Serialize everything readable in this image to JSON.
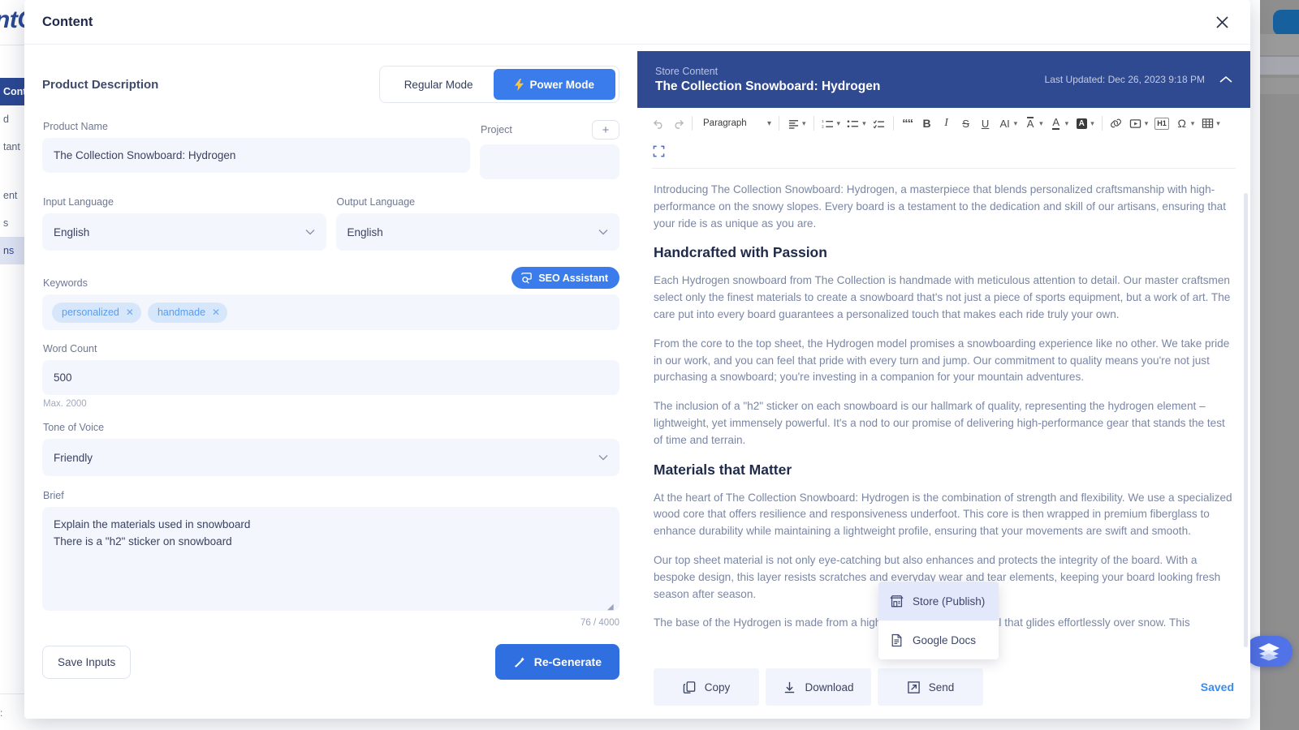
{
  "background": {
    "brand": "ntC",
    "nav": [
      {
        "label": "Conte",
        "state": "active"
      },
      {
        "label": "d",
        "state": "normal"
      },
      {
        "label": "tant",
        "state": "normal"
      },
      {
        "label": "ent",
        "state": "normal"
      },
      {
        "label": "s",
        "state": "normal"
      },
      {
        "label": "ns",
        "state": "sel"
      }
    ],
    "bottom_label": ":",
    "fab_icon": "layers-icon"
  },
  "modal": {
    "title": "Content",
    "close_icon": "close-icon"
  },
  "left": {
    "section_title": "Product Description",
    "modes": [
      {
        "label": "Regular Mode",
        "active": false,
        "icon": ""
      },
      {
        "label": "Power Mode",
        "active": true,
        "icon": "lightning-icon"
      }
    ],
    "product_name": {
      "label": "Product Name",
      "value": "The Collection Snowboard: Hydrogen"
    },
    "project": {
      "label": "Project",
      "value": "",
      "placeholder": "",
      "add_icon": "plus-icon"
    },
    "input_language": {
      "label": "Input Language",
      "value": "English"
    },
    "output_language": {
      "label": "Output Language",
      "value": "English"
    },
    "keywords": {
      "label": "Keywords",
      "seo_button": "SEO Assistant",
      "seo_icon": "seo-search-icon",
      "chips": [
        "personalized",
        "handmade"
      ]
    },
    "word_count": {
      "label": "Word Count",
      "value": "500",
      "hint": "Max. 2000"
    },
    "tone_of_voice": {
      "label": "Tone of Voice",
      "value": "Friendly"
    },
    "brief": {
      "label": "Brief",
      "value": "Explain the materials used in snowboard\nThere is a \"h2\" sticker on snowboard",
      "counter": "76 / 4000"
    },
    "save_inputs": "Save Inputs",
    "regenerate": "Re-Generate",
    "regenerate_icon": "magic-wand-icon"
  },
  "right": {
    "kicker": "Store Content",
    "title": "The Collection Snowboard: Hydrogen",
    "last_updated": "Last Updated: Dec 26, 2023 9:18 PM",
    "collapse_icon": "chevron-up-icon",
    "toolbar": {
      "undo": "undo-icon",
      "redo": "redo-icon",
      "block_format": "Paragraph",
      "align": "align-left-icon",
      "ordered_list": "ordered-list-icon",
      "bullet_list": "bullet-list-icon",
      "todo_list": "todo-list-icon",
      "blockquote": "““",
      "bold": "B",
      "italic": "I",
      "strikethrough": "S",
      "underline": "U",
      "font_size": "AI",
      "font_family": "A",
      "text_color": "A",
      "background_color": "A",
      "link": "link-icon",
      "media": "media-icon",
      "heading": "H1",
      "special_char": "Ω",
      "table": "table-icon",
      "fullscreen": "fullscreen-icon"
    },
    "document": [
      {
        "type": "p",
        "text": "Introducing The Collection Snowboard: Hydrogen, a masterpiece that blends personalized craftsmanship with high-performance on the snowy slopes. Every board is a testament to the dedication and skill of our artisans, ensuring that your ride is as unique as you are."
      },
      {
        "type": "h2",
        "text": "Handcrafted with Passion"
      },
      {
        "type": "p",
        "text": "Each Hydrogen snowboard from The Collection is handmade with meticulous attention to detail. Our master craftsmen select only the finest materials to create a snowboard that's not just a piece of sports equipment, but a work of art. The care put into every board guarantees a personalized touch that makes each ride truly your own."
      },
      {
        "type": "p",
        "text": "From the core to the top sheet, the Hydrogen model promises a snowboarding experience like no other. We take pride in our work, and you can feel that pride with every turn and jump. Our commitment to quality means you're not just purchasing a snowboard; you're investing in a companion for your mountain adventures."
      },
      {
        "type": "p",
        "text": "The inclusion of a \"h2\" sticker on each snowboard is our hallmark of quality, representing the hydrogen element – lightweight, yet immensely powerful. It's a nod to our promise of delivering high-performance gear that stands the test of time and terrain."
      },
      {
        "type": "h2",
        "text": "Materials that Matter"
      },
      {
        "type": "p",
        "text": "At the heart of The Collection Snowboard: Hydrogen is the combination of strength and flexibility. We use a specialized wood core that offers resilience and responsiveness underfoot. This core is then wrapped in premium fiberglass to enhance durability while maintaining a lightweight profile, ensuring that your movements are swift and smooth."
      },
      {
        "type": "p",
        "text": "Our top sheet material is not only eye-catching but also enhances and protects the integrity of the board. With a bespoke design, this layer resists scratches and everyday wear and tear elements, keeping your board looking fresh season after season."
      },
      {
        "type": "p",
        "text": "The base of the Hydrogen is made from a high-quality sintered material that glides effortlessly over snow. This"
      }
    ],
    "export_menu": [
      {
        "label": "Store (Publish)",
        "icon": "store-icon",
        "active": true
      },
      {
        "label": "Google Docs",
        "icon": "doc-icon",
        "active": false
      }
    ],
    "footer": {
      "buttons": [
        {
          "label": "Copy",
          "icon": "copy-icon"
        },
        {
          "label": "Download",
          "icon": "download-icon"
        },
        {
          "label": "Send",
          "icon": "send-icon"
        }
      ],
      "status": "Saved"
    }
  },
  "colors": {
    "accent_blue": "#3b7ced",
    "primary_blue": "#2f6fe0",
    "header_navy": "#2f4a91",
    "chip_bg": "#d6e7fb",
    "field_bg": "#f4f6fd",
    "saved_blue": "#3b8bef"
  }
}
